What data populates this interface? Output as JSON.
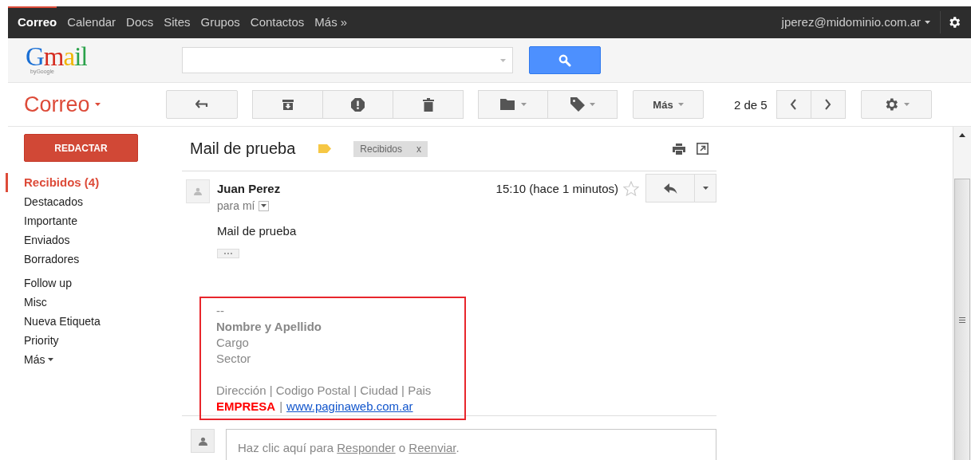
{
  "top_nav": {
    "items": [
      {
        "label": "Correo",
        "selected": true
      },
      {
        "label": "Calendar",
        "selected": false
      },
      {
        "label": "Docs",
        "selected": false
      },
      {
        "label": "Sites",
        "selected": false
      },
      {
        "label": "Grupos",
        "selected": false
      },
      {
        "label": "Contactos",
        "selected": false
      },
      {
        "label": "Más »",
        "selected": false
      }
    ],
    "account": "jperez@midominio.com.ar"
  },
  "header": {
    "logo": "Gmail",
    "logo_sub": "byGoogle"
  },
  "toolbar": {
    "app_title": "Correo",
    "more": "Más",
    "pager": "2 de 5"
  },
  "sidebar": {
    "compose": "REDACTAR",
    "system_labels": [
      {
        "label": "Recibidos (4)",
        "selected": true
      },
      {
        "label": "Destacados",
        "selected": false
      },
      {
        "label": "Importante",
        "selected": false
      },
      {
        "label": "Enviados",
        "selected": false
      },
      {
        "label": "Borradores",
        "selected": false
      }
    ],
    "user_labels": [
      {
        "label": "Follow up",
        "selected": false
      },
      {
        "label": "Misc",
        "selected": false
      },
      {
        "label": "Nueva Etiqueta",
        "selected": false
      },
      {
        "label": "Priority",
        "selected": false
      }
    ],
    "more": "Más"
  },
  "message": {
    "subject": "Mail de prueba",
    "label_chip": "Recibidos",
    "chip_close": "x",
    "sender": "Juan Perez",
    "recipient": "para mí",
    "time": "15:10 (hace 1 minutos)",
    "starred": false,
    "body": "Mail de prueba",
    "signature": {
      "separator": "--",
      "name": "Nombre y Apellido",
      "lines": [
        "Cargo",
        "Sector"
      ],
      "address": "Dirección | Codigo Postal | Ciudad | Pais",
      "company": "EMPRESA",
      "divider": "|",
      "website": "www.paginaweb.com.ar"
    },
    "reply_prompt": {
      "before": "Haz clic aquí para",
      "reply_link": "Responder",
      "middle": "o",
      "forward_link": "Reenviar",
      "after": "."
    }
  }
}
